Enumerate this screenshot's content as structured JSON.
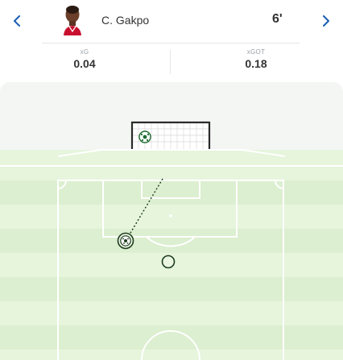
{
  "nav": {
    "prev_icon": "chevron-left-icon",
    "next_icon": "chevron-right-icon"
  },
  "player": {
    "name": "C. Gakpo",
    "avatar_icon": "player-avatar"
  },
  "shot": {
    "minute": "6'"
  },
  "stats": {
    "xg_label": "xG",
    "xg_value": "0.04",
    "xgot_label": "xGOT",
    "xgot_value": "0.18"
  },
  "colors": {
    "accent": "#1a5fb4",
    "pitch_light": "#e6f5dc",
    "pitch_stripe": "#dcefd0",
    "line": "#ffffff",
    "marker": "#1d3b1d"
  }
}
